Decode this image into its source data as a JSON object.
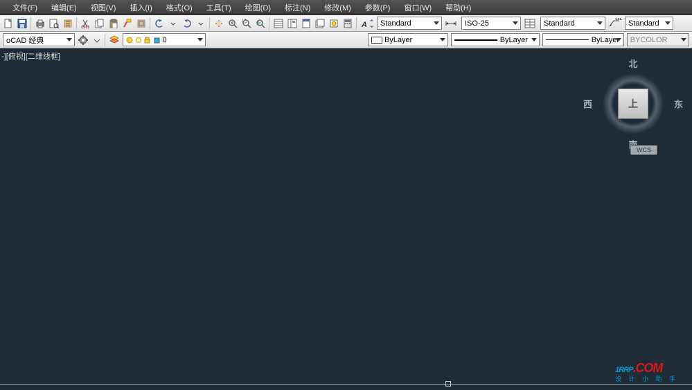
{
  "menu": {
    "file": "文件(F)",
    "edit": "编辑(E)",
    "view": "视图(V)",
    "insert": "插入(I)",
    "format": "格式(O)",
    "tools": "工具(T)",
    "draw": "绘图(D)",
    "dimension": "标注(N)",
    "modify": "修改(M)",
    "param": "参数(P)",
    "window": "窗口(W)",
    "help": "帮助(H)"
  },
  "style": {
    "text": "Standard",
    "dim": "ISO-25",
    "table": "Standard",
    "mleader": "Standard"
  },
  "props": {
    "workspace": "oCAD 经典",
    "layer": "0",
    "color_mode": "ByLayer",
    "linetype": "ByLayer",
    "lineweight": "ByLayer",
    "plotstyle": "BYCOLOR"
  },
  "viewport": {
    "label": "-][俯视][二维线框]"
  },
  "viewcube": {
    "face": "上",
    "n": "北",
    "s": "南",
    "e": "东",
    "w": "西",
    "wcs": "WCS"
  },
  "watermark": {
    "main": "1RRP",
    "dom": ".COM",
    "sub": "设 计 小 助 手"
  }
}
